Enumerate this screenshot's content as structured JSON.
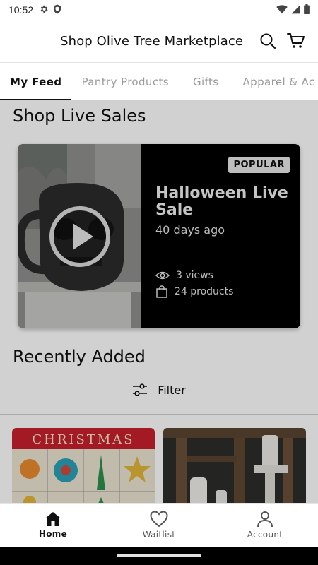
{
  "status_bar": {
    "time": "10:52"
  },
  "header": {
    "title": "Shop Olive Tree Marketplace"
  },
  "tabs": [
    {
      "label": "My Feed",
      "active": true
    },
    {
      "label": "Pantry Products",
      "active": false
    },
    {
      "label": "Gifts",
      "active": false
    },
    {
      "label": "Apparel & Ac",
      "active": false
    }
  ],
  "live_sales": {
    "section_title": "Shop Live Sales",
    "card": {
      "badge": "POPULAR",
      "title": "Halloween Live Sale",
      "age": "40 days ago",
      "views": "3 views",
      "products": "24 products"
    }
  },
  "recently_added": {
    "section_title": "Recently Added",
    "filter_label": "Filter",
    "tiles": [
      {
        "banner": "CHRISTMAS"
      },
      {
        "banner": ""
      }
    ]
  },
  "bottom_nav": {
    "items": [
      {
        "label": "Home",
        "icon": "home-icon",
        "active": true
      },
      {
        "label": "Waitlist",
        "icon": "heart-icon",
        "active": false
      },
      {
        "label": "Account",
        "icon": "account-icon",
        "active": false
      }
    ]
  },
  "colors": {
    "accent": "#111111",
    "card_bg": "#000000",
    "badge_bg": "#e8e8e8",
    "christmas_red": "#c8202d"
  }
}
